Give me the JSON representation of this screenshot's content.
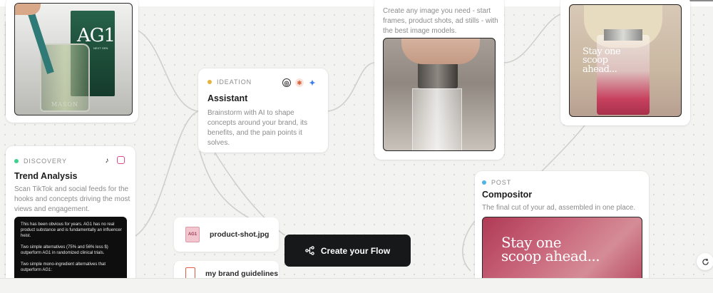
{
  "colors": {
    "ideation": "#e6b23a",
    "discovery": "#3fcf8e",
    "post": "#4fb3e6",
    "cta_bg": "#17181a"
  },
  "ag1_card": {
    "brand_text": "AG1",
    "subtext": "NEXT GEN",
    "jar_text": "MASON"
  },
  "ideation": {
    "tag": "IDEATION",
    "title": "Assistant",
    "description": "Brainstorm with AI to shape concepts around your brand, its benefits, and the pain points it solves.",
    "icons": [
      "openai-icon",
      "anthropic-icon",
      "gemini-icon"
    ]
  },
  "image_gen": {
    "description": "Create any image you need - start frames, product shots, ad stills - with the best image models."
  },
  "video_card": {
    "overlay": "Stay one scoop ahead..."
  },
  "discovery": {
    "tag": "DISCOVERY",
    "title": "Trend Analysis",
    "description": "Scan TikTok and social feeds for the hooks and concepts driving the most views and engagement.",
    "icons": [
      "tiktok-icon",
      "instagram-icon"
    ],
    "doc_lines": [
      "This has been obvious for years.  AG1 has no real product substance and is fundamentally an influencer heist.",
      "Two simple alternatives (75% and 56% less $) outperform AG1 in randomized clinical trials.",
      "Two simple mono-ingredient alternatives that outperform AG1:"
    ]
  },
  "post": {
    "tag": "POST",
    "title": "Compositor",
    "description": "The final cut of your ad, assembled in one place.",
    "overlay": "Stay one scoop ahead..."
  },
  "files": [
    {
      "name": "product-shot.jpg",
      "icon": "image-file-icon"
    },
    {
      "name": "my brand guidelines",
      "icon": "pdf-file-icon"
    }
  ],
  "cta": {
    "label": "Create your Flow",
    "icon": "flow-icon"
  },
  "controls": {
    "refresh_icon": "refresh-icon"
  }
}
